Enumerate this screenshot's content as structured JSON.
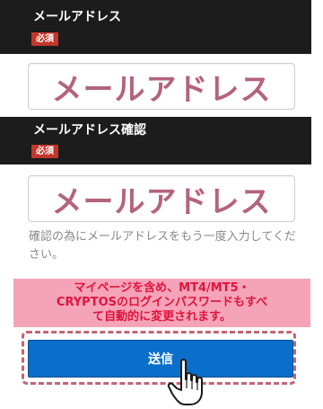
{
  "email": {
    "label": "メールアドレス",
    "required": "必須",
    "placeholder": "メールアドレス"
  },
  "email_confirm": {
    "label": "メールアドレス確認",
    "required": "必須",
    "placeholder": "メールアドレス",
    "helper": "確認の為にメールアドレスをもう一度入力してください。"
  },
  "notice": {
    "line1": "マイページを含め、MT4/MT5・",
    "line2": "CRYPTOSのログインパスワードもすべ",
    "line3": "て自動的に変更されます。"
  },
  "submit_label": "送信",
  "cursor_icon": "hand-pointer-icon",
  "colors": {
    "header_bg": "#1c1c1c",
    "badge": "#c2362c",
    "placeholder": "#b4647a",
    "notice_bg": "#f5a3b8",
    "notice_text": "#e0143c",
    "button": "#0a6fca",
    "dashed_border": "#c26476"
  }
}
